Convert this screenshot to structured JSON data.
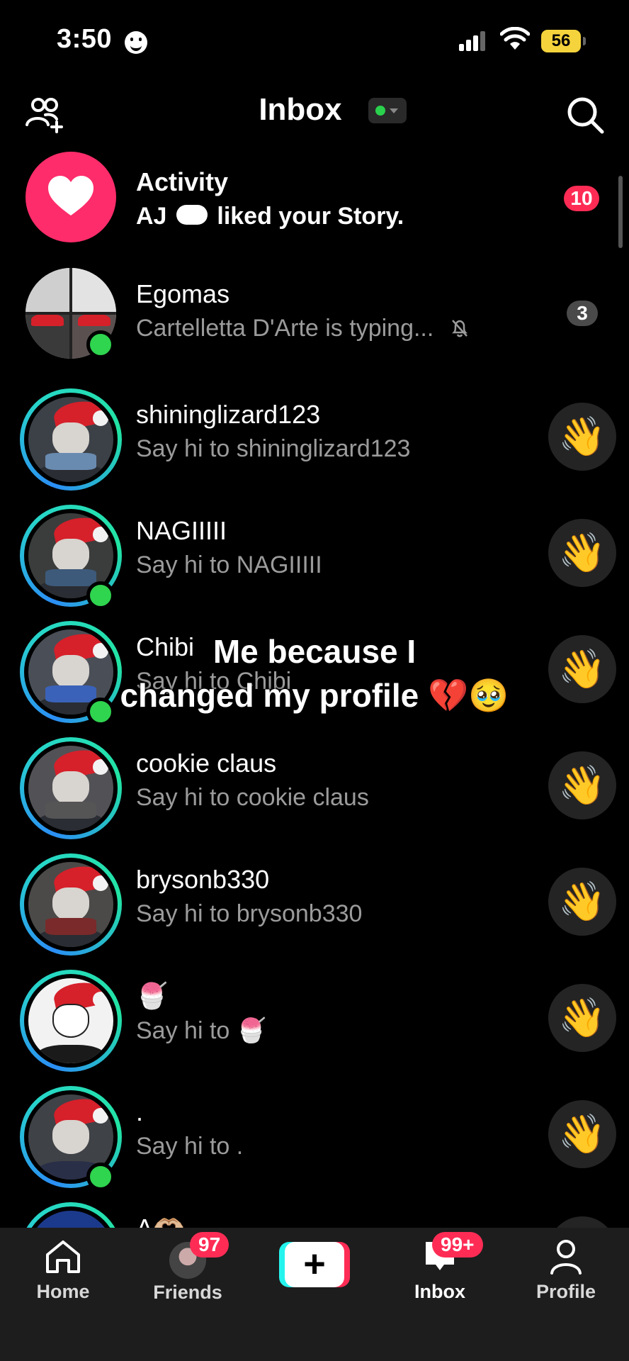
{
  "status_bar": {
    "time": "3:50",
    "battery": "56"
  },
  "header": {
    "title": "Inbox"
  },
  "activity": {
    "title": "Activity",
    "subtitle_prefix": "AJ",
    "subtitle_suffix": "liked your Story.",
    "badge": "10"
  },
  "group": {
    "name": "Egomas",
    "subtitle": "Cartelletta D'Arte is typing...",
    "badge": "3"
  },
  "chats": [
    {
      "name": "shininglizard123",
      "subtitle": "Say hi to shininglizard123",
      "wave": "👋"
    },
    {
      "name": "NAGIIIII",
      "subtitle": "Say hi to NAGIIIII",
      "wave": "👋"
    },
    {
      "name": "Chibi",
      "subtitle": "Say hi to Chibi",
      "wave": "👋"
    },
    {
      "name": "cookie claus",
      "subtitle": "Say hi to cookie claus",
      "wave": "👋"
    },
    {
      "name": "brysonb330",
      "subtitle": "Say hi to brysonb330",
      "wave": "👋"
    },
    {
      "name": "🍧",
      "subtitle": "Say hi to 🍧",
      "wave": "👋"
    },
    {
      "name": ".",
      "subtitle": "Say hi to .",
      "wave": "👋"
    },
    {
      "name": "A🫶🏼",
      "subtitle": "",
      "wave": "👋"
    }
  ],
  "caption": {
    "line1": "Me because I",
    "line2": "changed my profile  💔🥹"
  },
  "bottom_nav": {
    "home": "Home",
    "friends": "Friends",
    "friends_badge": "97",
    "create": "+",
    "inbox": "Inbox",
    "inbox_badge": "99+",
    "profile": "Profile"
  },
  "colors": {
    "accent": "#fe2c55",
    "online": "#2fd44f",
    "ring_start": "#2b8ef5",
    "ring_end": "#22e4a2"
  }
}
